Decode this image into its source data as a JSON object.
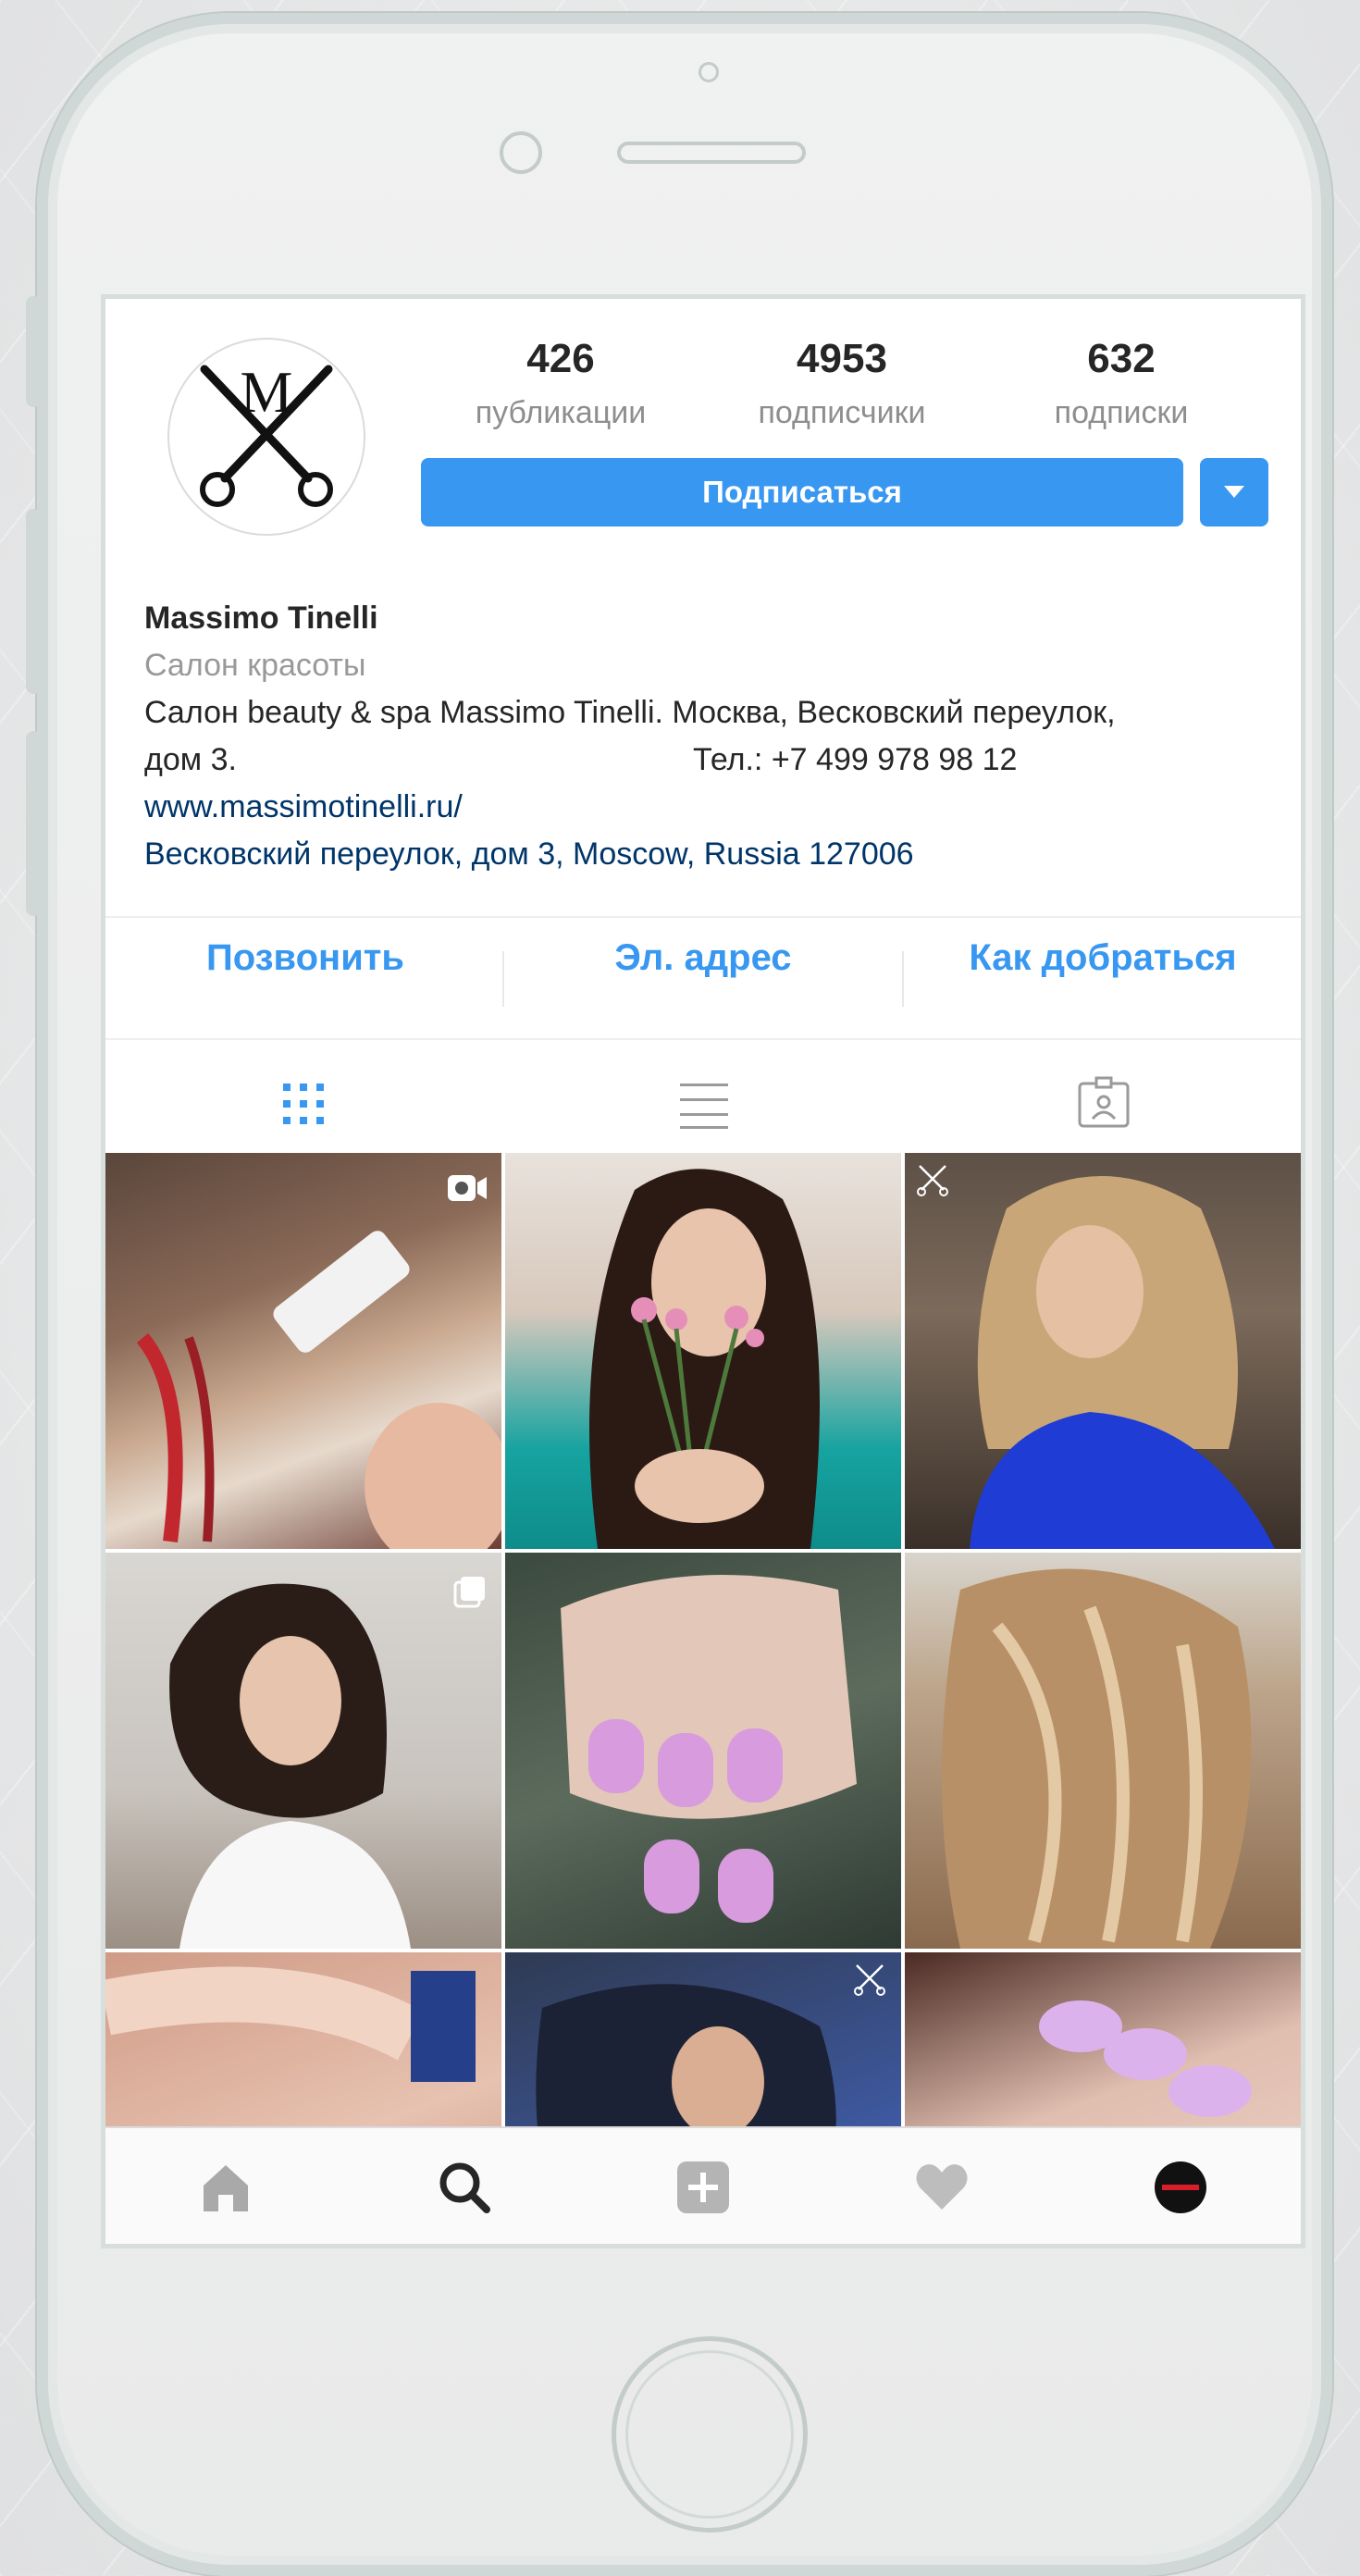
{
  "profile": {
    "avatar_logo_letter": "M",
    "stats": [
      {
        "value": "426",
        "label": "публикации"
      },
      {
        "value": "4953",
        "label": "подписчики"
      },
      {
        "value": "632",
        "label": "подписки"
      }
    ],
    "follow_label": "Подписаться",
    "name": "Massimo Tinelli",
    "category": "Салон красоты",
    "bio_line1": "Салон beauty & spa Massimo Tinelli. Москва, Весковский переулок,",
    "bio_line2": "дом 3.",
    "bio_phone": "Тел.: +7 499 978 98 12",
    "website": "www.massimotinelli.ru/",
    "address": "Весковский переулок, дом 3, Moscow, Russia 127006"
  },
  "actions": [
    {
      "label": "Позвонить"
    },
    {
      "label": "Эл. адрес"
    },
    {
      "label": "Как добраться"
    }
  ],
  "tabs": [
    {
      "icon": "grid-icon",
      "active": true
    },
    {
      "icon": "list-icon",
      "active": false
    },
    {
      "icon": "tagged-icon",
      "active": false
    }
  ],
  "posts": [
    {
      "subject": "hair-coloring",
      "badge": "video-icon"
    },
    {
      "subject": "woman-with-roses",
      "badge": ""
    },
    {
      "subject": "woman-blue-sweater",
      "badge": "logo-watermark"
    },
    {
      "subject": "woman-curly-hair",
      "badge": "carousel-icon"
    },
    {
      "subject": "pink-ombre-nails",
      "badge": "logo-watermark"
    },
    {
      "subject": "balayage-hair",
      "badge": ""
    },
    {
      "subject": "nude-nails",
      "badge": ""
    },
    {
      "subject": "woman-dark-hair",
      "badge": "logo-watermark"
    },
    {
      "subject": "lilac-nails",
      "badge": "logo-watermark"
    }
  ],
  "bottom_nav": [
    {
      "icon": "home-icon",
      "active": false
    },
    {
      "icon": "search-icon",
      "active": true
    },
    {
      "icon": "add-post-icon",
      "active": false
    },
    {
      "icon": "heart-icon",
      "active": false
    },
    {
      "icon": "profile-avatar-icon",
      "active": false
    }
  ],
  "colors": {
    "accent": "#3897f0",
    "link": "#003569",
    "text": "#262626",
    "muted": "#8e8e8e"
  }
}
